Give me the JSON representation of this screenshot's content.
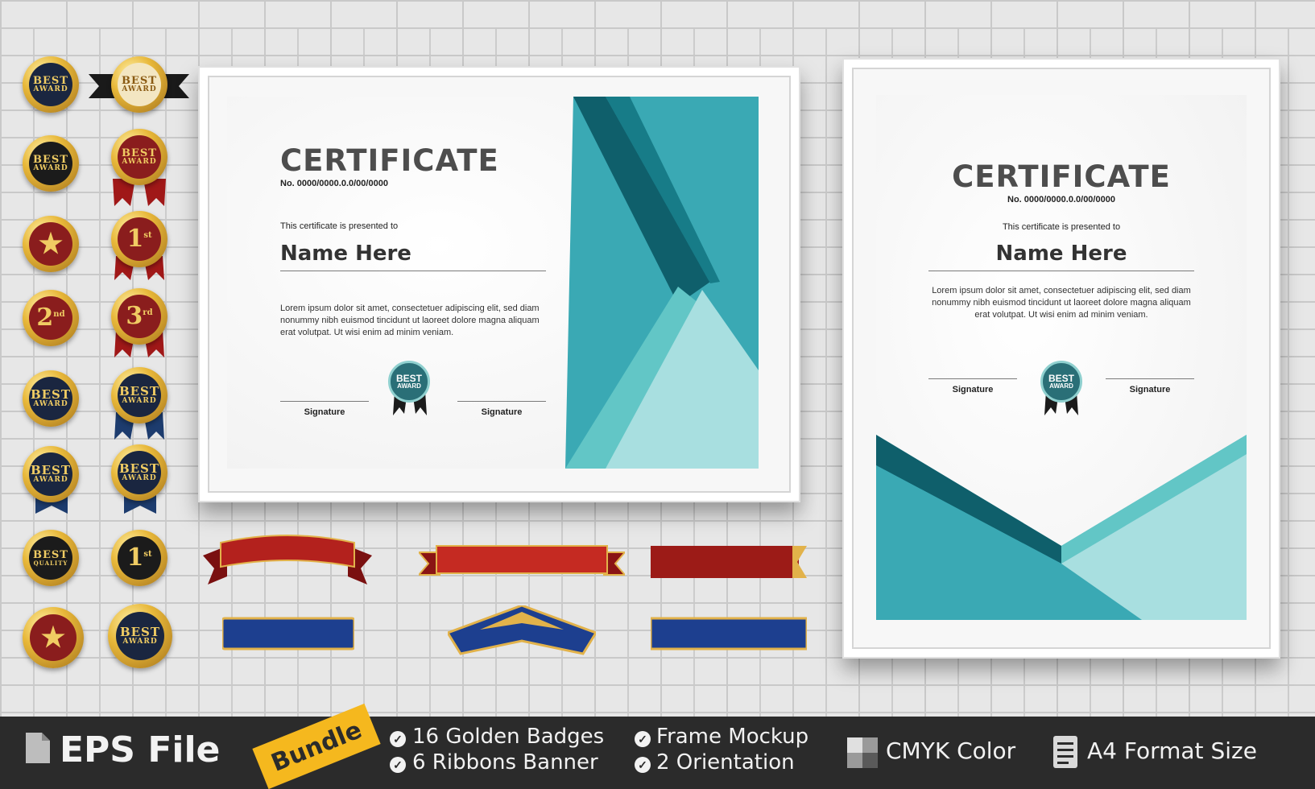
{
  "certificate_landscape": {
    "title": "CERTIFICATE",
    "number": "No. 0000/0000.0.0/00/0000",
    "presented_to": "This certificate is presented to",
    "name": "Name Here",
    "body": "Lorem ipsum dolor sit amet, consectetuer adipiscing elit, sed diam nonummy nibh euismod tincidunt ut laoreet dolore magna aliquam erat volutpat. Ut wisi enim ad minim veniam.",
    "signature_left": "Signature",
    "signature_right": "Signature",
    "badge_line1": "BEST",
    "badge_line2": "AWARD"
  },
  "certificate_portrait": {
    "title": "CERTIFICATE",
    "number": "No. 0000/0000.0.0/00/0000",
    "presented_to": "This certificate is presented to",
    "name": "Name Here",
    "body": "Lorem ipsum dolor sit amet, consectetuer adipiscing elit, sed diam nonummy nibh euismod tincidunt ut laoreet dolore magna aliquam erat volutpat. Ut wisi enim ad minim veniam.",
    "signature_left": "Signature",
    "signature_right": "Signature",
    "badge_line1": "BEST",
    "badge_line2": "AWARD"
  },
  "badges": {
    "best": "BEST",
    "award": "AWARD",
    "quality": "QUALITY",
    "first": "1",
    "first_sup": "st",
    "second": "2",
    "second_sup": "nd",
    "third": "3",
    "third_sup": "rd"
  },
  "bottom_bar": {
    "file_label": "EPS File",
    "bundle_tag": "Bundle",
    "feature_1": "16 Golden Badges",
    "feature_2": "6  Ribbons Banner",
    "feature_3": "Frame Mockup",
    "feature_4": "2 Orientation",
    "feature_5": "CMYK Color",
    "feature_6": "A4 Format Size"
  },
  "colors": {
    "teal_dark": "#0f5f6b",
    "teal": "#3aa9b4",
    "teal_light": "#a8dfe0",
    "gold": "#e8b83a",
    "ribbon_red": "#b0201c",
    "ribbon_blue": "#1d3f8f",
    "bar_bg": "#2b2b2b"
  }
}
